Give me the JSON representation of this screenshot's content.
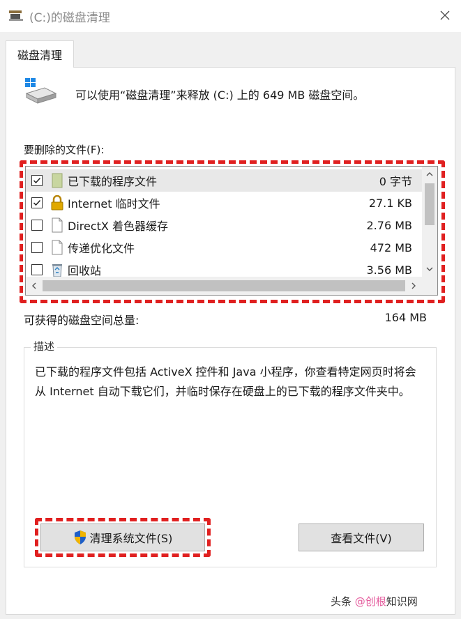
{
  "window": {
    "title": "(C:)的磁盘清理",
    "close_icon": "close-icon"
  },
  "tab": {
    "label": "磁盘清理"
  },
  "summary": {
    "text": "可以使用“磁盘清理”来释放  (C:) 上的 649 MB 磁盘空间。"
  },
  "files": {
    "label": "要删除的文件(F):",
    "rows": [
      {
        "name": "已下载的程序文件",
        "size": "0 字节",
        "checked": true,
        "icon": "folder-icon"
      },
      {
        "name": "Internet 临时文件",
        "size": "27.1 KB",
        "checked": true,
        "icon": "lock-icon"
      },
      {
        "name": "DirectX 着色器缓存",
        "size": "2.76 MB",
        "checked": false,
        "icon": "document-icon"
      },
      {
        "name": "传递优化文件",
        "size": "472 MB",
        "checked": false,
        "icon": "document-icon"
      },
      {
        "name": "回收站",
        "size": "3.56 MB",
        "checked": false,
        "icon": "recycle-bin-icon"
      }
    ]
  },
  "total": {
    "label": "可获得的磁盘空间总量:",
    "value": "164 MB"
  },
  "description": {
    "legend": "描述",
    "text": "已下载的程序文件包括 ActiveX 控件和 Java 小程序，你查看特定网页时将会从 Internet 自动下载它们，并临时保存在硬盘上的已下载的程序文件夹中。"
  },
  "buttons": {
    "cleanup_system": "清理系统文件(S)",
    "view_files": "查看文件(V)"
  },
  "watermark": {
    "prefix": "头条 ",
    "brand": "@创根",
    "suffix": "知识网"
  },
  "colors": {
    "highlight": "#e02020",
    "selection": "#e8e8e8"
  }
}
